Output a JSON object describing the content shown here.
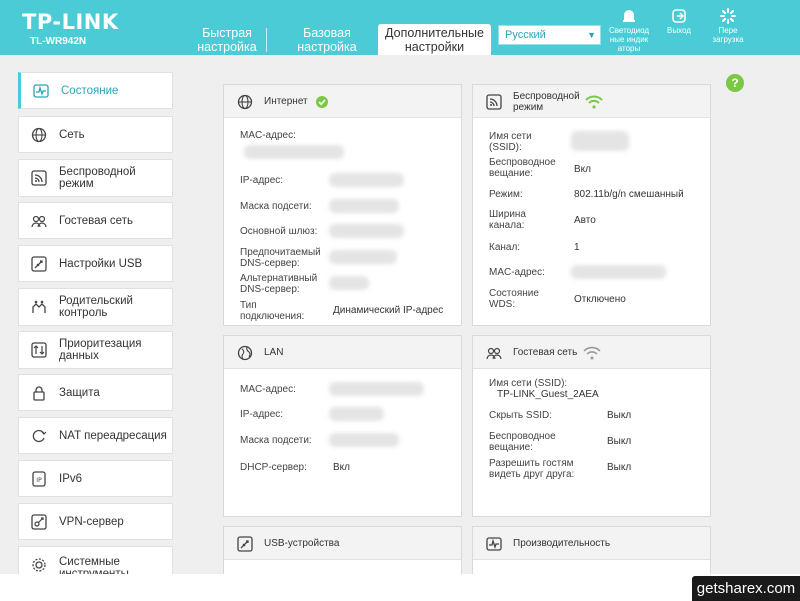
{
  "header": {
    "logo": "TP-LINK",
    "model": "TL-WR942N",
    "tabs": [
      {
        "label_line1": "Быстрая",
        "label_line2": "настройка"
      },
      {
        "label_line1": "Базовая",
        "label_line2": "настройка"
      },
      {
        "label_line1": "Дополнительные",
        "label_line2": "настройки"
      }
    ],
    "language": "Русский",
    "buttons": [
      {
        "line1": "Светодиод",
        "line2": "ные индик",
        "line3": "аторы"
      },
      {
        "line1": "Выход"
      },
      {
        "line1": "Пере",
        "line2": "загрузка"
      }
    ]
  },
  "sidebar": {
    "items": [
      {
        "label": "Состояние",
        "icon": "status-icon"
      },
      {
        "label": "Сеть",
        "icon": "globe-icon"
      },
      {
        "label": "Беспроводной режим",
        "icon": "wireless-icon"
      },
      {
        "label": "Гостевая сеть",
        "icon": "guest-icon"
      },
      {
        "label": "Настройки USB",
        "icon": "usb-icon"
      },
      {
        "label": "Родительский контроль",
        "icon": "parental-icon"
      },
      {
        "label": "Приоритезация данных",
        "icon": "qos-icon"
      },
      {
        "label": "Защита",
        "icon": "lock-icon"
      },
      {
        "label": "NAT переадресация",
        "icon": "nat-icon"
      },
      {
        "label": "IPv6",
        "icon": "ipv6-icon"
      },
      {
        "label": "VPN-сервер",
        "icon": "vpn-icon"
      },
      {
        "label": "Системные инструменты",
        "icon": "tools-icon"
      }
    ]
  },
  "internet": {
    "title": "Интернет",
    "mac_label": "MAC-адрес:",
    "ip_label": "IP-адрес:",
    "mask_label": "Маска подсети:",
    "gateway_label": "Основной шлюз:",
    "dns1_label_1": "Предпочитаемый",
    "dns1_label_2": "DNS-сервер:",
    "dns2_label_1": "Альтернативный",
    "dns2_label_2": "DNS-сервер:",
    "conn_label_1": "Тип",
    "conn_label_2": "подключения:",
    "conn_value": "Динамический IP-адрес"
  },
  "wireless": {
    "title_1": "Беспроводной",
    "title_2": "режим",
    "ssid_label_1": "Имя сети",
    "ssid_label_2": "(SSID):",
    "broadcast_label_1": "Беспроводное",
    "broadcast_label_2": "вещание:",
    "broadcast_value": "Вкл",
    "mode_label": "Режим:",
    "mode_value": "802.11b/g/n смешанный",
    "width_label_1": "Ширина",
    "width_label_2": "канала:",
    "width_value": "Авто",
    "channel_label": "Канал:",
    "channel_value": "1",
    "mac_label": "MAC-адрес:",
    "wds_label_1": "Состояние",
    "wds_label_2": "WDS:",
    "wds_value": "Отключено"
  },
  "lan": {
    "title": "LAN",
    "mac_label": "MAC-адрес:",
    "ip_label": "IP-адрес:",
    "mask_label": "Маска подсети:",
    "dhcp_label": "DHCP-сервер:",
    "dhcp_value": "Вкл"
  },
  "guest": {
    "title": "Гостевая сеть",
    "ssid_label": "Имя сети (SSID):",
    "ssid_value": "TP-LINK_Guest_2AEA",
    "hide_label": "Скрыть SSID:",
    "hide_value": "Выкл",
    "broadcast_label_1": "Беспроводное",
    "broadcast_label_2": "вещание:",
    "broadcast_value": "Выкл",
    "isolation_label_1": "Разрешить гостям",
    "isolation_label_2": "видеть друг друга:",
    "isolation_value": "Выкл"
  },
  "usb": {
    "title": "USB-устройства"
  },
  "performance": {
    "title": "Производительность"
  },
  "help": "?",
  "watermark": "getsharex.com",
  "colors": {
    "accent": "#4acbd6",
    "ok": "#7ac943"
  }
}
